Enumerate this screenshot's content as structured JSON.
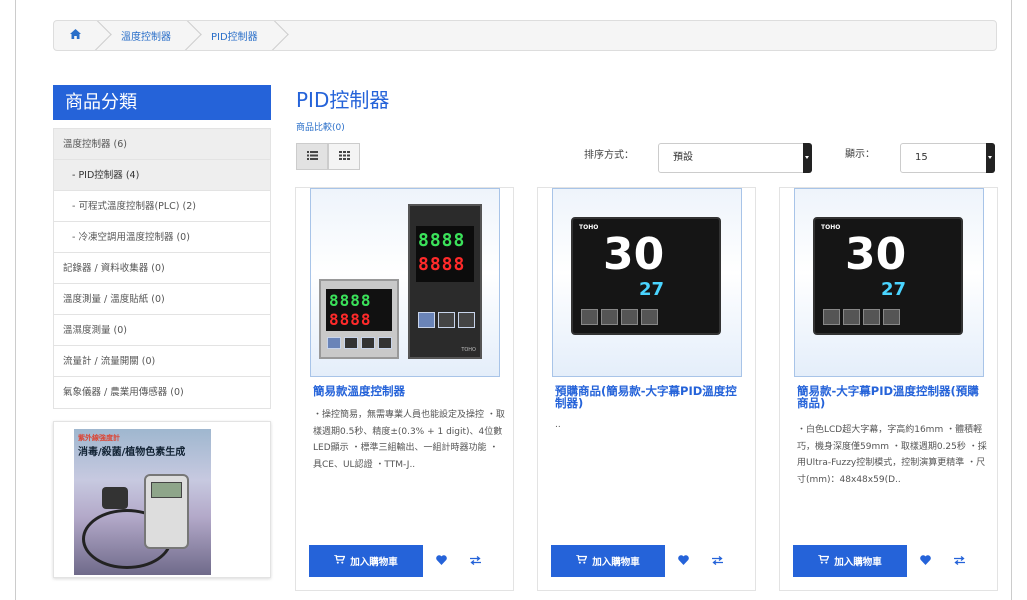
{
  "breadcrumb": [
    "溫度控制器",
    "PID控制器"
  ],
  "sidebar": {
    "title": "商品分類",
    "items": [
      {
        "label": "溫度控制器 (6)",
        "level": "top"
      },
      {
        "label": "- PID控制器 (4)",
        "level": "sub",
        "active": true
      },
      {
        "label": "- 可程式溫度控制器(PLC) (2)",
        "level": "sub"
      },
      {
        "label": "- 冷凍空調用溫度控制器 (0)",
        "level": "sub"
      },
      {
        "label": "記錄器 / 資料收集器 (0)",
        "level": "top"
      },
      {
        "label": "溫度測量 / 溫度貼紙 (0)",
        "level": "top"
      },
      {
        "label": "溫濕度測量 (0)",
        "level": "top"
      },
      {
        "label": "流量計 / 流量開關 (0)",
        "level": "top"
      },
      {
        "label": "氣象儀器 / 農業用傳感器 (0)",
        "level": "top"
      }
    ],
    "banner": {
      "line1": "紫外線強度計",
      "line2": "消毒/殺菌/植物色素生成"
    }
  },
  "main": {
    "title": "PID控制器",
    "compare": "商品比較(0)",
    "sort_label": "排序方式：",
    "sort_value": "預設",
    "show_label": "顯示：",
    "show_value": "15"
  },
  "products": [
    {
      "name": "簡易款溫度控制器",
      "desc": "・操控簡易，無需專業人員也能設定及操控 ・取樣週期0.5秒、精度±(0.3% + 1 digit)、4位數LED顯示 ・標準三組輸出、一組計時器功能 ・具CE、UL認證 ・TTM-J..",
      "cart": "加入購物車",
      "display_top": "8888",
      "display_bottom": "8888",
      "brand": "TOHO"
    },
    {
      "name": "預購商品(簡易款-大字幕PID溫度控制器)",
      "desc": "..",
      "cart": "加入購物車",
      "display_big": "30",
      "display_small": "27",
      "brand": "TOHO"
    },
    {
      "name": "簡易款-大字幕PID溫度控制器(預購商品)",
      "desc": "・白色LCD超大字幕，字高約16mm ・體積輕巧，機身深度僅59mm ・取樣週期0.25秒 ・採用Ultra-Fuzzy控制模式，控制演算更精準 ・尺寸(mm)：48x48x59(D..",
      "cart": "加入購物車",
      "display_big": "30",
      "display_small": "27",
      "brand": "TOHO"
    }
  ],
  "colors": {
    "accent": "#2563d9"
  },
  "icons": [
    "home-icon",
    "list-view-icon",
    "grid-view-icon",
    "cart-icon",
    "heart-icon",
    "compare-icon"
  ]
}
